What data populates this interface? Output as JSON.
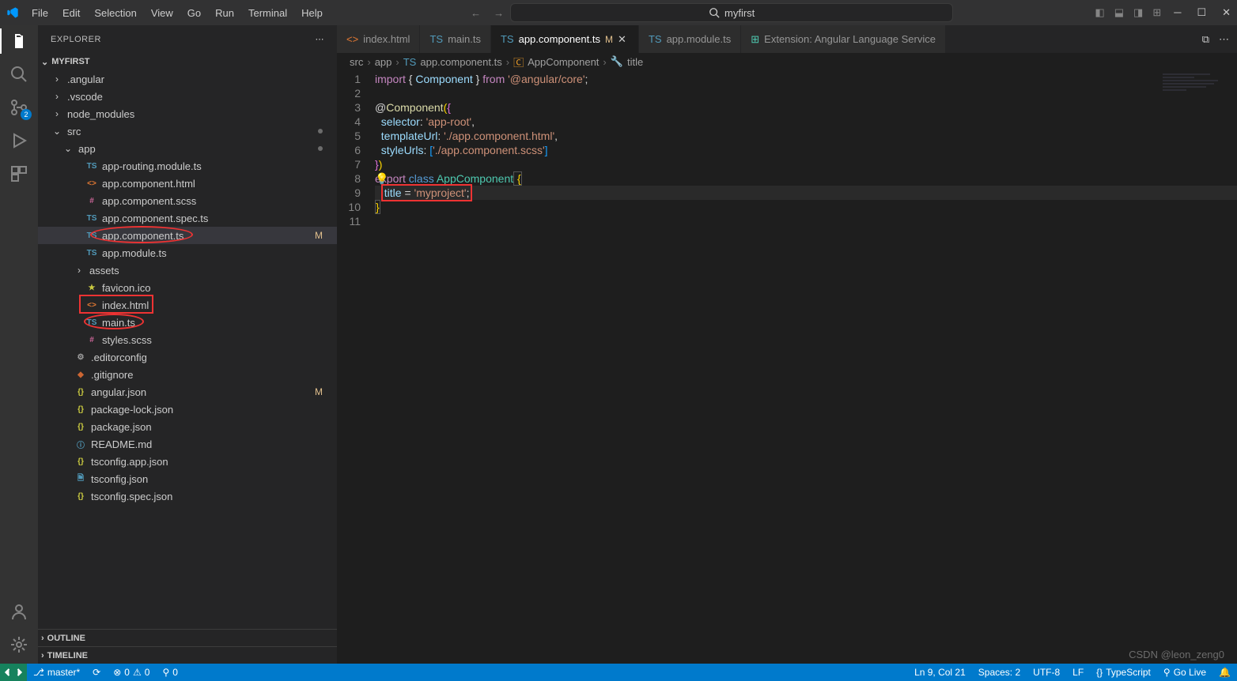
{
  "menu": {
    "file": "File",
    "edit": "Edit",
    "selection": "Selection",
    "view": "View",
    "go": "Go",
    "run": "Run",
    "terminal": "Terminal",
    "help": "Help"
  },
  "search_label": "myfirst",
  "sidebar": {
    "title": "EXPLORER",
    "project": "MYFIRST",
    "outline": "OUTLINE",
    "timeline": "TIMELINE",
    "scm_badge": "2"
  },
  "tree": {
    "angular": ".angular",
    "vscode": ".vscode",
    "node_modules": "node_modules",
    "src": "src",
    "app": "app",
    "app_routing": "app-routing.module.ts",
    "app_html": "app.component.html",
    "app_scss": "app.component.scss",
    "app_spec": "app.component.spec.ts",
    "app_ts": "app.component.ts",
    "app_module": "app.module.ts",
    "assets": "assets",
    "favicon": "favicon.ico",
    "index": "index.html",
    "main": "main.ts",
    "styles": "styles.scss",
    "editorconfig": ".editorconfig",
    "gitignore": ".gitignore",
    "angular_json": "angular.json",
    "pkg_lock": "package-lock.json",
    "pkg": "package.json",
    "readme": "README.md",
    "tsconfig_app": "tsconfig.app.json",
    "tsconfig": "tsconfig.json",
    "tsconfig_spec": "tsconfig.spec.json",
    "mod_badge": "M"
  },
  "tabs": {
    "index": "index.html",
    "main": "main.ts",
    "app_ts": "app.component.ts",
    "app_ts_mod": "M",
    "app_module": "app.module.ts",
    "ext": "Extension: Angular Language Service"
  },
  "breadcrumbs": {
    "src": "src",
    "app": "app",
    "file": "app.component.ts",
    "class": "AppComponent",
    "member": "title"
  },
  "code": {
    "l1a": "import",
    "l1b": " { ",
    "l1c": "Component",
    "l1d": " } ",
    "l1e": "from",
    "l1f": " '@angular/core'",
    "l1g": ";",
    "l3a": "@",
    "l3b": "Component",
    "l3c": "(",
    "l3d": "{",
    "l4a": "  selector",
    "l4b": ": ",
    "l4c": "'app-root'",
    "l4d": ",",
    "l5a": "  templateUrl",
    "l5b": ": ",
    "l5c": "'./app.component.html'",
    "l5d": ",",
    "l6a": "  styleUrls",
    "l6b": ": ",
    "l6c": "[",
    "l6d": "'./app.component.scss'",
    "l6e": "]",
    "l7a": "}",
    "l7b": ")",
    "l8a": "export",
    "l8b": " class ",
    "l8c": "AppComponent",
    "l8d": " {",
    "l9a": "  ",
    "l9b": "title",
    "l9c": " = ",
    "l9d": "'myproject'",
    "l9e": ";",
    "l10a": "}"
  },
  "status": {
    "branch": "master*",
    "errors": "0",
    "warnings": "0",
    "ports": "0",
    "cursor": "Ln 9, Col 21",
    "spaces": "Spaces: 2",
    "encoding": "UTF-8",
    "eol": "LF",
    "lang": "TypeScript",
    "golive": "Go Live"
  },
  "watermark": "CSDN @leon_zeng0"
}
